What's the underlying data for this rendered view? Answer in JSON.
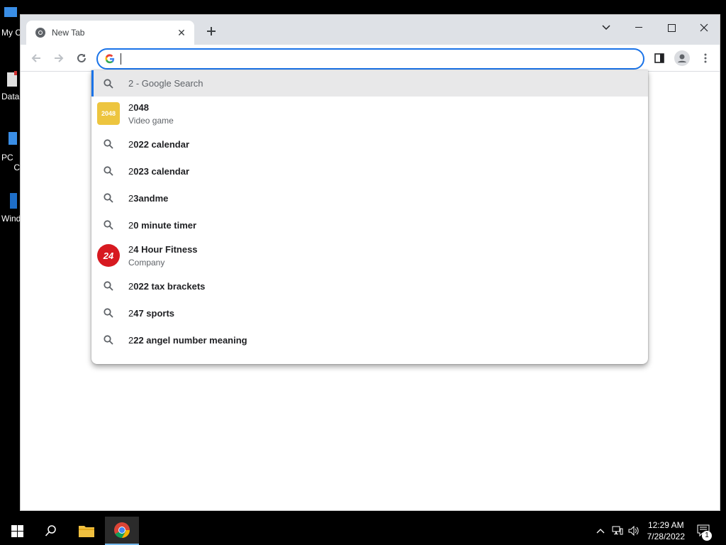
{
  "desktop": {
    "icons": [
      {
        "label": "My C",
        "icon": "computer-icon"
      },
      {
        "label": "Data",
        "icon": "database-icon"
      },
      {
        "label": "PC",
        "label2": "C",
        "icon": "pc-icon"
      },
      {
        "label": "Wind",
        "icon": "windows-icon"
      }
    ]
  },
  "browser": {
    "tab": {
      "title": "New Tab",
      "icon": "chrome-icon"
    },
    "omnibox": {
      "value": "",
      "icon": "google-icon"
    },
    "colors": {
      "accent": "#1a73e8",
      "tabstrip": "#dee1e6"
    }
  },
  "suggestions": [
    {
      "kind": "search",
      "typed": "2",
      "rest": " - Google Search",
      "selected": true
    },
    {
      "kind": "entity",
      "typed": "2",
      "rest": "048",
      "subtitle": "Video game",
      "thumb": "2048",
      "thumb_color": "#edc53f"
    },
    {
      "kind": "search",
      "typed": "2",
      "rest": "022 calendar"
    },
    {
      "kind": "search",
      "typed": "2",
      "rest": "023 calendar"
    },
    {
      "kind": "search",
      "typed": "2",
      "rest": "3andme"
    },
    {
      "kind": "search",
      "typed": "2",
      "rest": "0 minute timer"
    },
    {
      "kind": "entity",
      "typed": "2",
      "rest": "4 Hour Fitness",
      "subtitle": "Company",
      "thumb": "24",
      "thumb_color": "#d71920"
    },
    {
      "kind": "search",
      "typed": "2",
      "rest": "022 tax brackets"
    },
    {
      "kind": "search",
      "typed": "2",
      "rest": "47 sports"
    },
    {
      "kind": "search",
      "typed": "2",
      "rest": "22 angel number meaning"
    }
  ],
  "taskbar": {
    "time": "12:29 AM",
    "date": "7/28/2022",
    "notification_count": "1"
  }
}
